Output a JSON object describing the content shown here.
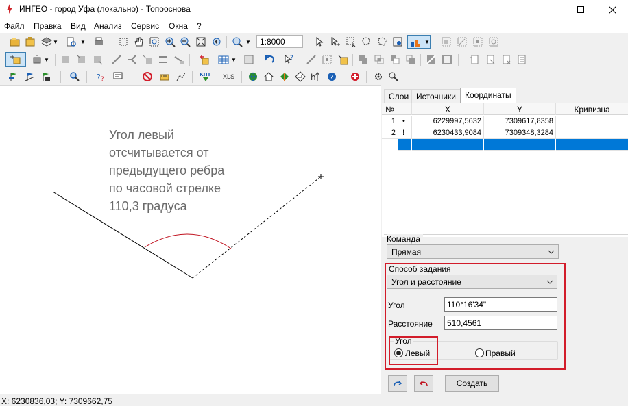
{
  "window": {
    "title": "ИНГЕО - город Уфа (локально) - Топооснова"
  },
  "menu": {
    "items": [
      "Файл",
      "Правка",
      "Вид",
      "Анализ",
      "Сервис",
      "Окна",
      "?"
    ]
  },
  "toolbar": {
    "scale": "1:8000"
  },
  "canvas": {
    "annotation_lines": [
      "Угол левый",
      "отсчитывается от",
      "предыдущего ребра",
      "по часовой стрелке",
      "110,3 градуса"
    ],
    "colors": {
      "arc": "#c0121f",
      "line": "#000000",
      "annotation": "#6b6b6b"
    }
  },
  "panel": {
    "tabs": [
      {
        "label": "Слои",
        "active": false
      },
      {
        "label": "Источники",
        "active": false
      },
      {
        "label": "Координаты",
        "active": true
      }
    ],
    "grid": {
      "columns": [
        "№",
        "X",
        "Y",
        "Кривизна"
      ],
      "rows": [
        {
          "num": "1",
          "marker": "•",
          "x": "6229997,5632",
          "y": "7309617,8358",
          "curv": ""
        },
        {
          "num": "2",
          "marker": "!",
          "x": "6230433,9084",
          "y": "7309348,3284",
          "curv": ""
        }
      ]
    },
    "command": {
      "label": "Команда",
      "value": "Прямая"
    },
    "method": {
      "label": "Способ задания",
      "value": "Угол и расстояние"
    },
    "angle_field": {
      "label": "Угол",
      "value": "110°16'34\""
    },
    "distance_field": {
      "label": "Расстояние",
      "value": "510,4561"
    },
    "angle_group": {
      "title": "Угол",
      "left_label": "Левый",
      "right_label": "Правый",
      "selected": "left"
    },
    "create_button": "Создать",
    "highlight_color": "#d21c2a"
  },
  "status": {
    "coords": "X: 6230836,03; Y: 7309662,75"
  }
}
